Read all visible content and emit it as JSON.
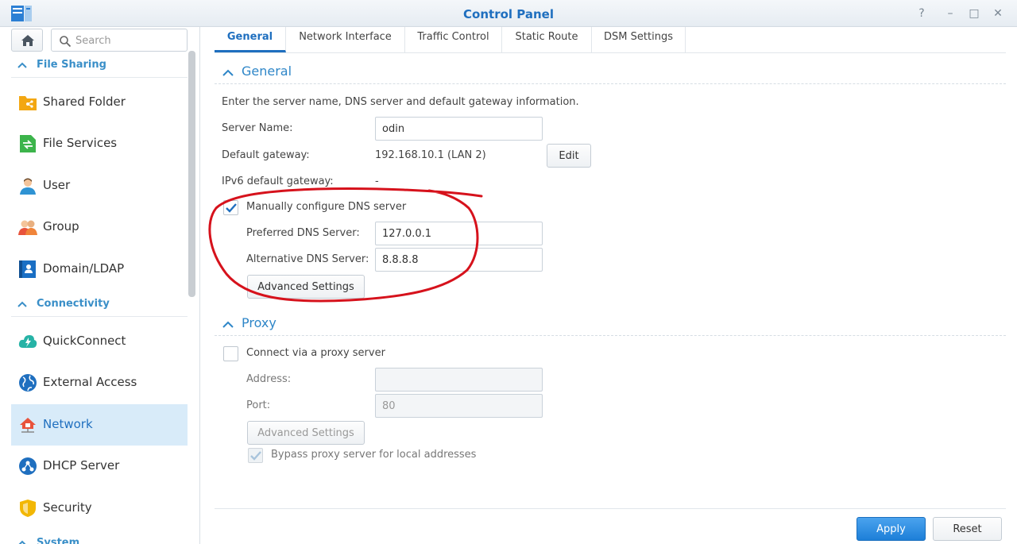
{
  "window": {
    "title": "Control Panel",
    "help_glyph": "?",
    "minimize_glyph": "–",
    "maximize_glyph": "□",
    "close_glyph": "✕"
  },
  "sidebar": {
    "search_placeholder": "Search",
    "sections": [
      {
        "label": "File Sharing"
      },
      {
        "label": "Connectivity"
      },
      {
        "label": "System"
      }
    ],
    "items": [
      {
        "label": "Shared Folder",
        "icon": "shared-folder-icon"
      },
      {
        "label": "File Services",
        "icon": "file-services-icon"
      },
      {
        "label": "User",
        "icon": "user-icon"
      },
      {
        "label": "Group",
        "icon": "group-icon"
      },
      {
        "label": "Domain/LDAP",
        "icon": "domain-ldap-icon"
      },
      {
        "label": "QuickConnect",
        "icon": "quickconnect-icon"
      },
      {
        "label": "External Access",
        "icon": "external-access-icon"
      },
      {
        "label": "Network",
        "icon": "network-icon",
        "active": true
      },
      {
        "label": "DHCP Server",
        "icon": "dhcp-server-icon"
      },
      {
        "label": "Security",
        "icon": "security-icon"
      }
    ]
  },
  "tabs": [
    {
      "label": "General",
      "active": true
    },
    {
      "label": "Network Interface"
    },
    {
      "label": "Traffic Control"
    },
    {
      "label": "Static Route"
    },
    {
      "label": "DSM Settings"
    }
  ],
  "general": {
    "heading": "General",
    "description": "Enter the server name, DNS server and default gateway information.",
    "server_name_label": "Server Name:",
    "server_name_value": "odin",
    "default_gateway_label": "Default gateway:",
    "default_gateway_value": "192.168.10.1 (LAN 2)",
    "edit_label": "Edit",
    "ipv6_gateway_label": "IPv6 default gateway:",
    "ipv6_gateway_value": "-",
    "manual_dns_label": "Manually configure DNS server",
    "manual_dns_checked": true,
    "preferred_dns_label": "Preferred DNS Server:",
    "preferred_dns_value": "127.0.0.1",
    "alternative_dns_label": "Alternative DNS Server:",
    "alternative_dns_value": "8.8.8.8",
    "advanced_settings_label": "Advanced Settings"
  },
  "proxy": {
    "heading": "Proxy",
    "connect_label": "Connect via a proxy server",
    "connect_checked": false,
    "address_label": "Address:",
    "address_value": "",
    "port_label": "Port:",
    "port_value": "80",
    "advanced_settings_label": "Advanced Settings",
    "bypass_label": "Bypass proxy server for local addresses",
    "bypass_checked": true
  },
  "footer": {
    "apply_label": "Apply",
    "reset_label": "Reset"
  },
  "colors": {
    "accent": "#1f6fbf",
    "annotation": "#d6121c",
    "active_bg": "#d8ebf9"
  }
}
